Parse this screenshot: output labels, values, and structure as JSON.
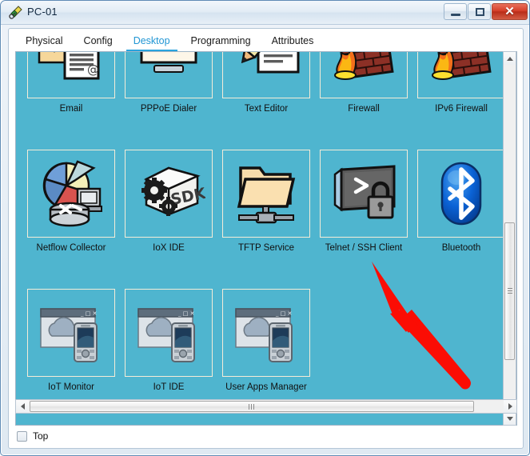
{
  "window": {
    "title": "PC-01",
    "title_icon": "packet-tracer-icon",
    "buttons": {
      "minimize": "minimize-icon",
      "maximize": "maximize-icon",
      "close": "✕"
    }
  },
  "tabs": [
    {
      "label": "Physical",
      "active": false
    },
    {
      "label": "Config",
      "active": false
    },
    {
      "label": "Desktop",
      "active": true
    },
    {
      "label": "Programming",
      "active": false
    },
    {
      "label": "Attributes",
      "active": false
    }
  ],
  "desktop": {
    "background_color": "#4fb5cf",
    "cell_border_color": "#f5ecd8",
    "rows": [
      [
        {
          "label": "Email",
          "icon": "email-icon"
        },
        {
          "label": "PPPoE Dialer",
          "icon": "pppoe-dialer-icon"
        },
        {
          "label": "Text Editor",
          "icon": "text-editor-icon"
        },
        {
          "label": "Firewall",
          "icon": "firewall-icon"
        },
        {
          "label": "IPv6 Firewall",
          "icon": "ipv6-firewall-icon"
        }
      ],
      [
        {
          "label": "Netflow Collector",
          "icon": "netflow-collector-icon"
        },
        {
          "label": "IoX IDE",
          "icon": "iox-ide-icon"
        },
        {
          "label": "TFTP Service",
          "icon": "tftp-service-icon"
        },
        {
          "label": "Telnet / SSH Client",
          "icon": "telnet-ssh-client-icon"
        },
        {
          "label": "Bluetooth",
          "icon": "bluetooth-icon"
        }
      ],
      [
        {
          "label": "IoT Monitor",
          "icon": "iot-monitor-icon"
        },
        {
          "label": "IoT IDE",
          "icon": "iot-ide-icon"
        },
        {
          "label": "User Apps Manager",
          "icon": "user-apps-manager-icon"
        }
      ]
    ]
  },
  "bottom": {
    "top_checkbox_label": "Top",
    "top_checkbox_checked": false
  },
  "annotation": {
    "arrow_color": "#fb0d04",
    "points_at": "Telnet / SSH Client"
  },
  "scrollbars": {
    "vertical_up": "scroll-up-arrow",
    "vertical_down": "scroll-down-arrow",
    "horizontal_left": "scroll-left-arrow",
    "horizontal_right": "scroll-right-arrow"
  }
}
